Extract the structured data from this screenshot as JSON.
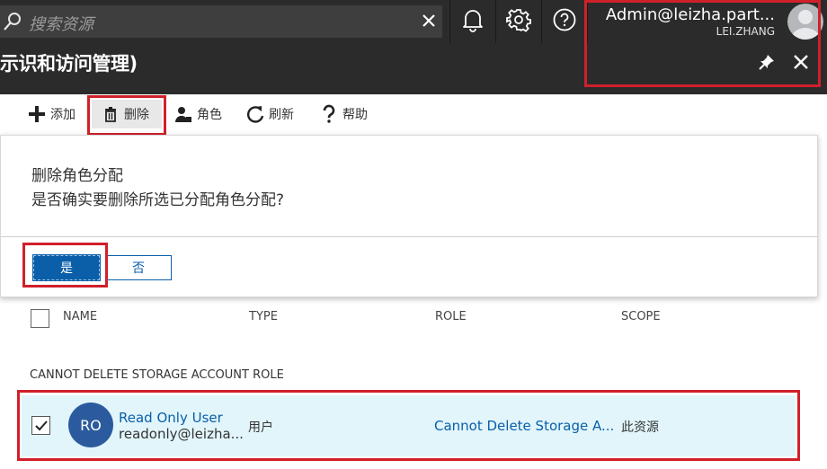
{
  "search": {
    "placeholder": "搜索资源"
  },
  "user": {
    "email": "Admin@leizha.part...",
    "org": "LEI.ZHANG"
  },
  "blade": {
    "title": "示识和访问管理)"
  },
  "toolbar": {
    "add": "添加",
    "delete": "删除",
    "role": "角色",
    "refresh": "刷新",
    "help": "帮助"
  },
  "dialog": {
    "title": "删除角色分配",
    "message": "是否确实要删除所选已分配角色分配?",
    "yes": "是",
    "no": "否"
  },
  "table": {
    "columns": {
      "name": "NAME",
      "type": "TYPE",
      "role": "ROLE",
      "scope": "SCOPE"
    },
    "group_label": "CANNOT DELETE STORAGE ACCOUNT ROLE",
    "rows": [
      {
        "initials": "RO",
        "name": "Read Only User",
        "email": "readonly@leizha...",
        "type": "用户",
        "role": "Cannot Delete Storage A...",
        "scope": "此资源",
        "checked": true
      }
    ]
  },
  "colors": {
    "chrome": "#2b2b2b",
    "accent": "#0a5fa8",
    "highlight": "#d0202a",
    "row_selected": "#e1f5fb",
    "avatar": "#2b5b9e"
  }
}
